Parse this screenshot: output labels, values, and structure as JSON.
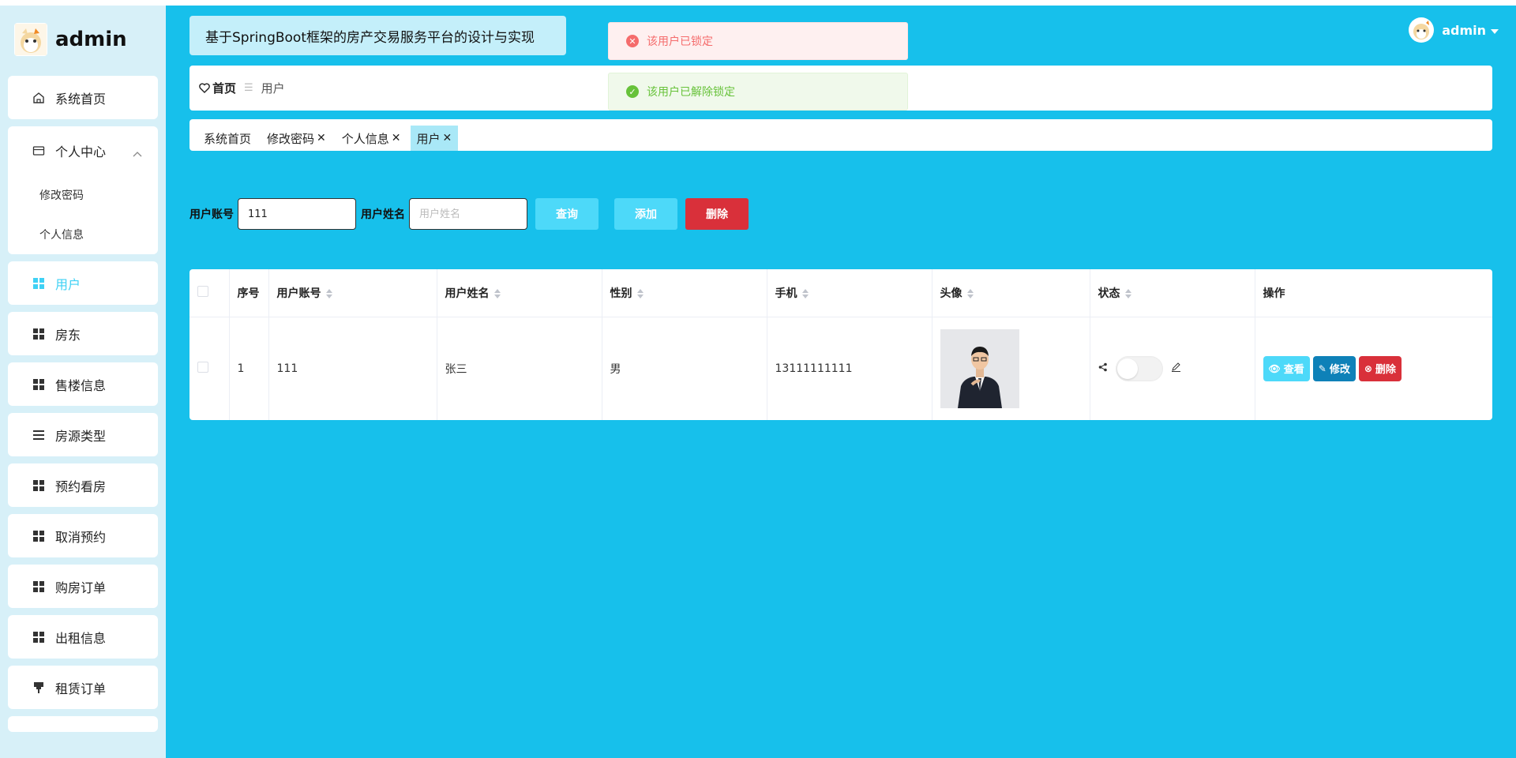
{
  "brand": {
    "title": "admin"
  },
  "sidebar": {
    "items": [
      {
        "label": "系统首页",
        "icon": "home-icon"
      },
      {
        "label": "个人中心",
        "icon": "id-card-icon",
        "children": [
          "修改密码",
          "个人信息"
        ]
      },
      {
        "label": "用户",
        "icon": "grid-icon",
        "active": true
      },
      {
        "label": "房东",
        "icon": "grid-icon"
      },
      {
        "label": "售楼信息",
        "icon": "grid-icon"
      },
      {
        "label": "房源类型",
        "icon": "list-icon"
      },
      {
        "label": "预约看房",
        "icon": "grid-icon"
      },
      {
        "label": "取消预约",
        "icon": "grid-icon"
      },
      {
        "label": "购房订单",
        "icon": "grid-icon"
      },
      {
        "label": "出租信息",
        "icon": "grid-icon"
      },
      {
        "label": "租赁订单",
        "icon": "pin-icon"
      }
    ]
  },
  "header": {
    "title": "基于SpringBoot框架的房产交易服务平台的设计与实现",
    "user": "admin"
  },
  "breadcrumb": {
    "home": "首页",
    "current": "用户"
  },
  "tags": [
    {
      "label": "系统首页",
      "closable": false
    },
    {
      "label": "修改密码",
      "closable": true
    },
    {
      "label": "个人信息",
      "closable": true
    },
    {
      "label": "用户",
      "closable": true,
      "active": true
    }
  ],
  "toasts": {
    "error": "该用户已锁定",
    "success": "该用户已解除锁定"
  },
  "search": {
    "account_label": "用户账号",
    "account_value": "111",
    "name_label": "用户姓名",
    "name_placeholder": "用户姓名",
    "query_btn": "查询",
    "add_btn": "添加",
    "delete_btn": "删除"
  },
  "table": {
    "headers": [
      "序号",
      "用户账号",
      "用户姓名",
      "性别",
      "手机",
      "头像",
      "状态",
      "操作"
    ],
    "rows": [
      {
        "index": "1",
        "account": "111",
        "name": "张三",
        "gender": "男",
        "phone": "13111111111",
        "status_on": false
      }
    ],
    "actions": {
      "view": "查看",
      "edit": "修改",
      "delete": "删除"
    }
  },
  "colors": {
    "background": "#17c0eb",
    "sidebar": "#d7f0f8",
    "accent": "#4dd9f9",
    "danger": "#d9303a",
    "edit": "#0e81b8"
  }
}
